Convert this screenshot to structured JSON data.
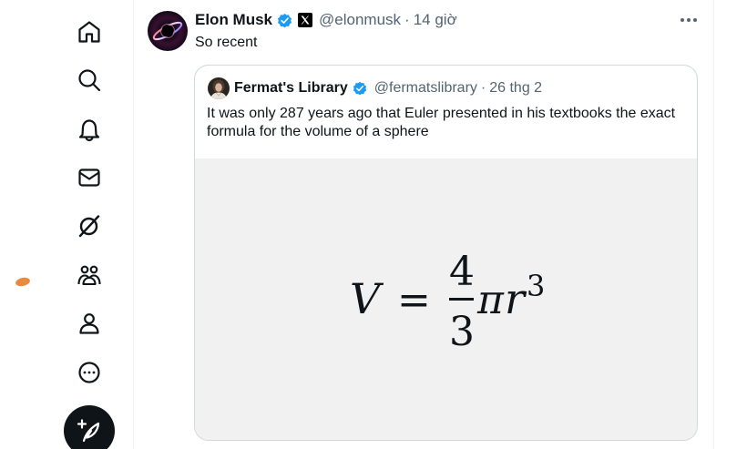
{
  "nav": {
    "items": [
      {
        "name": "home",
        "icon": "home-icon"
      },
      {
        "name": "explore",
        "icon": "search-icon"
      },
      {
        "name": "notifications",
        "icon": "bell-icon"
      },
      {
        "name": "messages",
        "icon": "envelope-icon"
      },
      {
        "name": "grok",
        "icon": "grok-icon"
      },
      {
        "name": "communities",
        "icon": "communities-icon"
      },
      {
        "name": "profile",
        "icon": "person-icon"
      },
      {
        "name": "more",
        "icon": "more-circle-icon"
      }
    ],
    "compose_icon": "feather-plus-icon"
  },
  "tweet": {
    "author": "Elon Musk",
    "handle": "@elonmusk",
    "separator": "·",
    "time": "14 giờ",
    "text": "So recent",
    "verified": true,
    "affiliate_badge": "x-logo-icon",
    "quote": {
      "author": "Fermat's Library",
      "handle": "@fermatslibrary",
      "separator": "·",
      "time": "26 thg 2",
      "text": "It was only 287 years ago that Euler presented in his textbooks the exact formula for the volume of a sphere",
      "verified": true,
      "formula": {
        "lhs": "V",
        "equals": "=",
        "numerator": "4",
        "denominator": "3",
        "pi": "π",
        "r": "r",
        "exponent": "3"
      }
    }
  },
  "colors": {
    "verified_blue": "#1d9bf0",
    "text_primary": "#0f1419",
    "text_secondary": "#536471",
    "border": "#cfd9de",
    "media_bg": "#f1f1f1"
  }
}
